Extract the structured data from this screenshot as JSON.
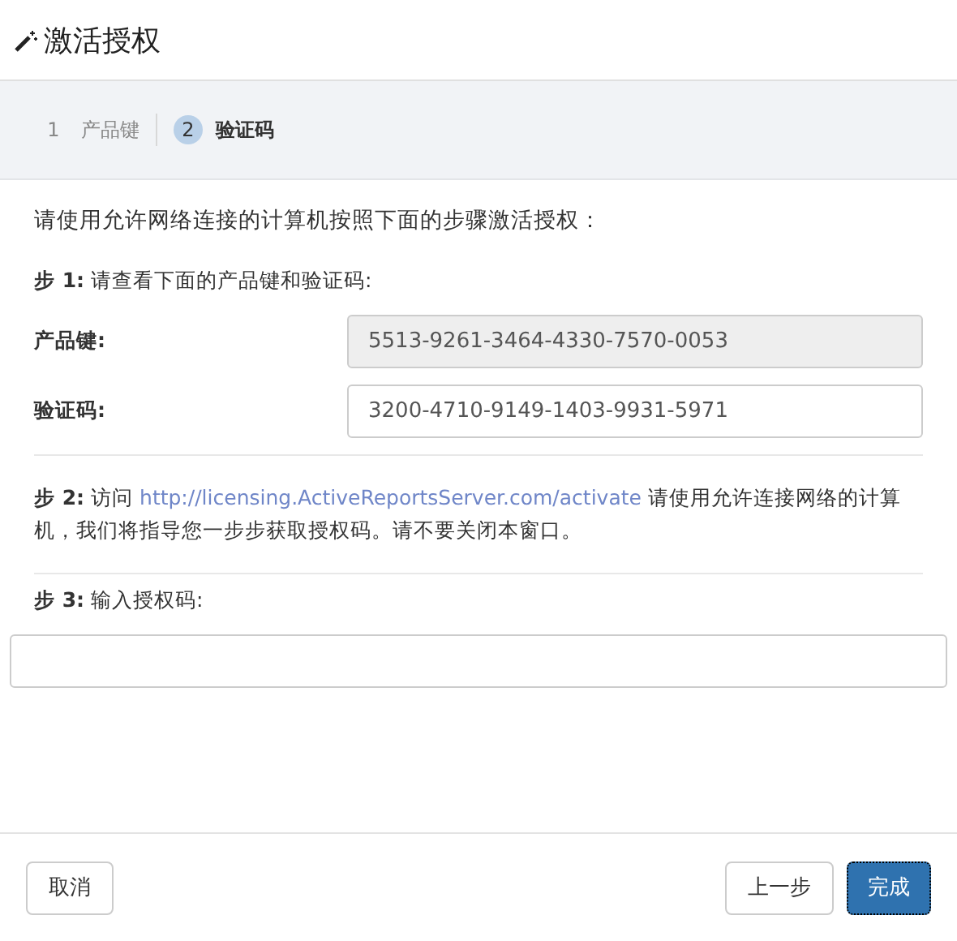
{
  "window": {
    "title": "激活授权"
  },
  "steps": [
    {
      "number": "1",
      "label": "产品键",
      "selected": false
    },
    {
      "number": "2",
      "label": "验证码",
      "selected": true
    }
  ],
  "intro": "请使用允许网络连接的计算机按照下面的步骤激活授权：",
  "step1": {
    "title": "步 1:",
    "text": "请查看下面的产品键和验证码:"
  },
  "fields": [
    {
      "label": "产品键:",
      "value": "5513-9261-3464-4330-7570-0053",
      "disabled": true
    },
    {
      "label": "验证码:",
      "value": "3200-4710-9149-1403-9931-5971",
      "disabled": false
    }
  ],
  "step2": {
    "title": "步 2:",
    "before": "访问",
    "link": "http://licensing.ActiveReportsServer.com/activate",
    "after": "请使用允许连接网络的计算机，我们将指导您一步步获取授权码。请不要关闭本窗口。"
  },
  "step3": {
    "title": "步 3:",
    "text": "输入授权码:"
  },
  "buttons": [
    {
      "label": "取消",
      "kind": "default"
    },
    {
      "label": "上一步",
      "kind": "default"
    },
    {
      "label": "完成",
      "kind": "primary"
    }
  ]
}
